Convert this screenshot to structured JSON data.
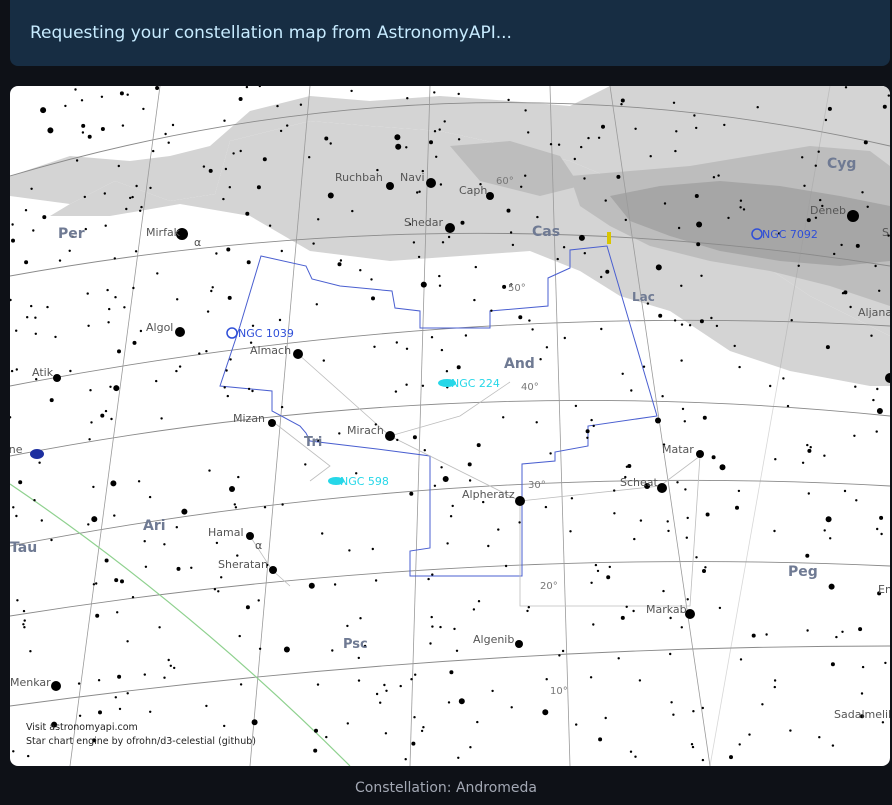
{
  "status_banner": {
    "text": "Requesting your constellation map from AstronomyAPI..."
  },
  "caption": {
    "text": "Constellation: Andromeda"
  },
  "chart": {
    "credits": [
      "Visit astronomyapi.com",
      "Star chart engine by ofrohn/d3-celestial (github)"
    ],
    "constellations": [
      "Per",
      "Cas",
      "Cyg",
      "And",
      "Lac",
      "Tri",
      "Ari",
      "Tau",
      "Peg",
      "Psc"
    ],
    "stars": [
      "Mirfak",
      "Ruchbah",
      "Navi",
      "Caph",
      "Shedar",
      "Deneb",
      "Algol",
      "Almach",
      "Atik",
      "Mizan",
      "Mirach",
      "Alpheratz",
      "Matar",
      "Scheat",
      "Hamal",
      "Sheratan",
      "Markab",
      "Algenib",
      "Menkar",
      "Sadalmelik",
      "Aljanah"
    ],
    "deep_sky": [
      "NGC 1039",
      "NGC 224",
      "NGC 598",
      "NGC 7092"
    ],
    "declination_labels": [
      "60°",
      "50°",
      "40°",
      "30°",
      "20°",
      "10°"
    ],
    "greek": [
      "α",
      "α"
    ],
    "edge_labels": [
      "S",
      "En"
    ],
    "partial_label": "one"
  }
}
